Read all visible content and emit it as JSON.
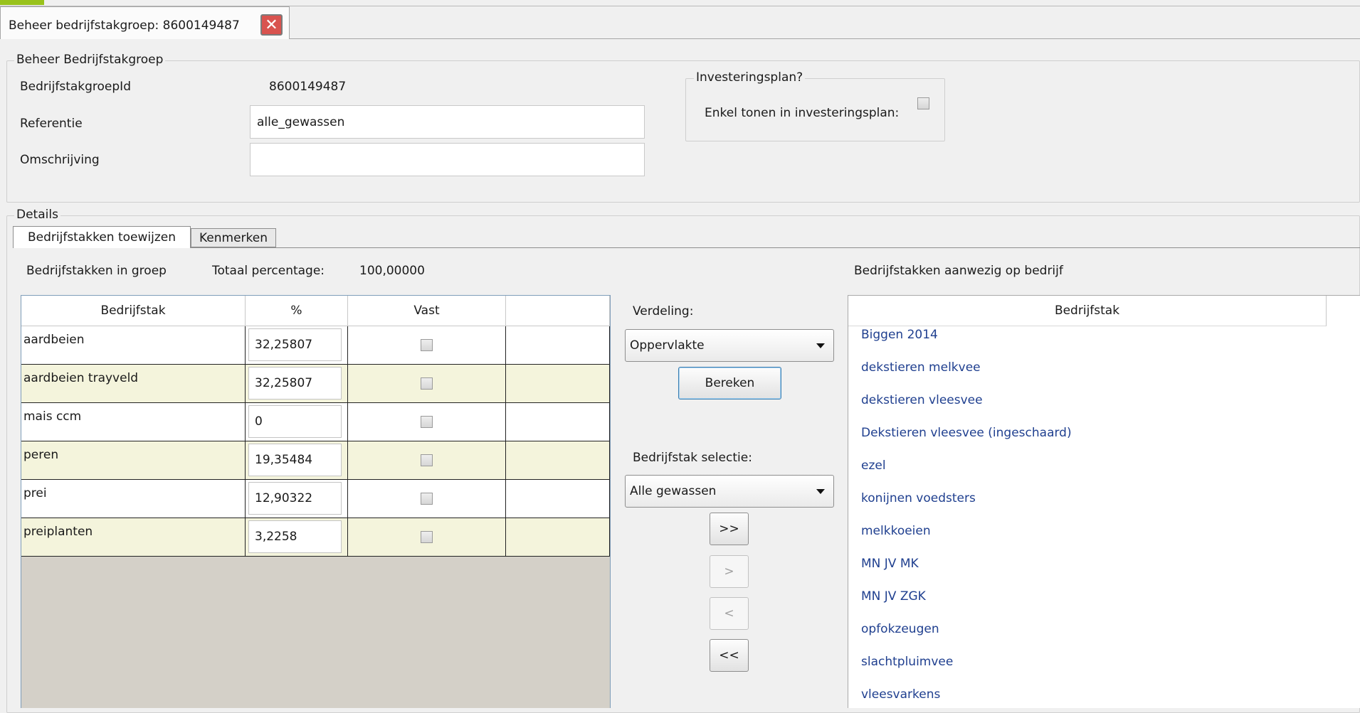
{
  "document_tab": {
    "title": "Beheer bedrijfstakgroep: 8600149487"
  },
  "group": {
    "legend": "Beheer Bedrijfstakgroep",
    "id_label": "BedrijfstakgroepId",
    "id_value": "8600149487",
    "referentie_label": "Referentie",
    "referentie_value": "alle_gewassen",
    "omschrijving_label": "Omschrijving",
    "omschrijving_value": ""
  },
  "investment": {
    "legend": "Investeringsplan?",
    "only_show_label": "Enkel tonen in investeringsplan:",
    "only_show_checked": false
  },
  "details": {
    "legend": "Details",
    "tabs": [
      {
        "label": "Bedrijfstakken toewijzen",
        "active": true
      },
      {
        "label": "Kenmerken",
        "active": false
      }
    ],
    "in_group_label": "Bedrijfstakken in groep",
    "total_label": "Totaal percentage:",
    "total_value": "100,00000",
    "grid": {
      "columns": [
        "Bedrijfstak",
        "%",
        "Vast",
        ""
      ],
      "rows": [
        {
          "name": "aardbeien",
          "pct": "32,25807",
          "vast": false
        },
        {
          "name": "aardbeien trayveld",
          "pct": "32,25807",
          "vast": false
        },
        {
          "name": "mais ccm",
          "pct": "0",
          "vast": false
        },
        {
          "name": "peren",
          "pct": "19,35484",
          "vast": false
        },
        {
          "name": "prei",
          "pct": "12,90322",
          "vast": false
        },
        {
          "name": "preiplanten",
          "pct": "3,2258",
          "vast": false
        }
      ]
    },
    "controls": {
      "verdeling_label": "Verdeling:",
      "verdeling_value": "Oppervlakte",
      "bereken_label": "Bereken",
      "selectie_label": "Bedrijfstak selectie:",
      "selectie_value": "Alle gewassen",
      "add_all": ">>",
      "add_one": ">",
      "remove_one": "<",
      "remove_all": "<<"
    },
    "available": {
      "title": "Bedrijfstakken aanwezig op bedrijf",
      "column": "Bedrijfstak",
      "items": [
        "Biggen 2014",
        "dekstieren melkvee",
        "dekstieren vleesvee",
        "Dekstieren vleesvee (ingeschaard)",
        "ezel",
        "konijnen voedsters",
        "melkkoeien",
        "MN JV MK",
        "MN JV ZGK",
        "opfokzeugen",
        "slachtpluimvee",
        "vleesvarkens"
      ]
    }
  },
  "colors": {
    "accent_green": "#99c21c",
    "close_red": "#d9534f",
    "row_alt": "#f4f4dc",
    "list_text": "#1f3f8f",
    "grid_empty": "#d4d0c8"
  }
}
